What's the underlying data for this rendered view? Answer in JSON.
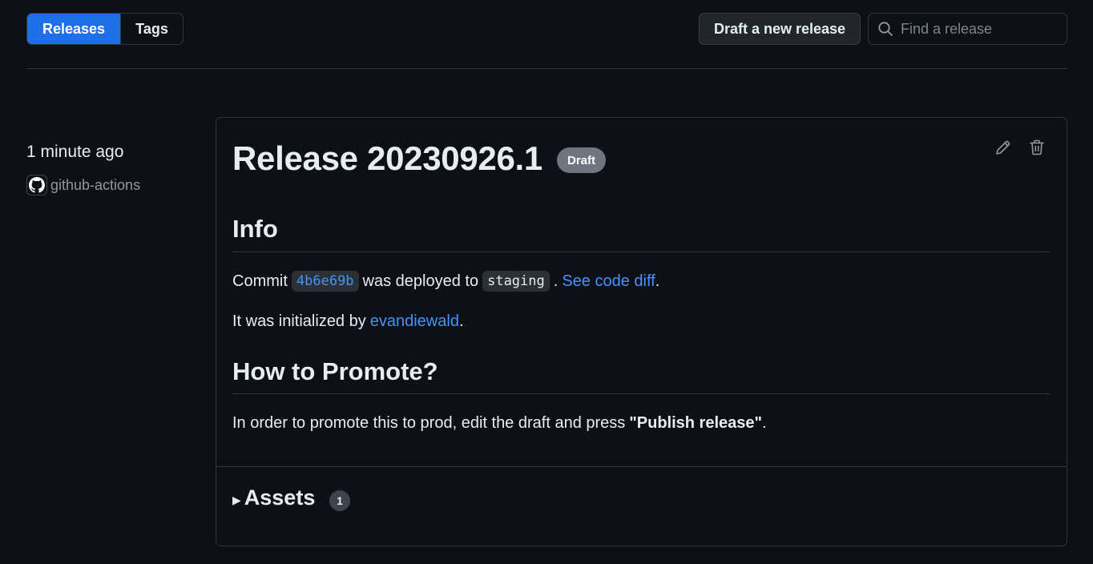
{
  "tabs": {
    "releases": "Releases",
    "tags": "Tags"
  },
  "header": {
    "draft_button": "Draft a new release",
    "search_placeholder": "Find a release"
  },
  "release": {
    "time": "1 minute ago",
    "author": "github-actions",
    "title": "Release 20230926.1",
    "badge": "Draft",
    "info_heading": "Info",
    "commit_prefix": "Commit",
    "commit_sha": "4b6e69b",
    "deployed_text": "was deployed to",
    "environment": "staging",
    "period1": ".",
    "diff_link": "See code diff",
    "period2": ".",
    "initialized_prefix": "It was initialized by",
    "initializer": "evandiewald",
    "period3": ".",
    "promote_heading": "How to Promote?",
    "promote_text": "In order to promote this to prod, edit the draft and press",
    "promote_bold": "\"Publish release\"",
    "period4": ".",
    "assets_label": "Assets",
    "assets_count": "1"
  },
  "icons": {
    "search": "search-icon",
    "edit": "pencil-icon",
    "delete": "trash-icon",
    "avatar": "github-mark-icon",
    "expand": "triangle-right-icon"
  },
  "colors": {
    "background": "#0d1117",
    "accent": "#1f6feb",
    "link": "#4493f8",
    "border": "#30363d",
    "badge": "#6e7681"
  }
}
